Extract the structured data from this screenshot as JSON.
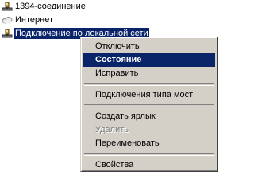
{
  "connections": [
    {
      "label": "1394-соединение",
      "icon": "network-connection-icon"
    },
    {
      "label": "Интернет",
      "icon": "internet-cloud-icon"
    },
    {
      "label": "Подключение по локальной сети",
      "icon": "network-connection-icon",
      "selected": true
    }
  ],
  "context_menu": {
    "items": [
      {
        "label": "Отключить"
      },
      {
        "label": "Состояние",
        "default": true,
        "highlighted": true
      },
      {
        "label": "Исправить"
      },
      {
        "label": "Подключения типа мост"
      },
      {
        "label": "Создать ярлык"
      },
      {
        "label": "Удалить",
        "disabled": true
      },
      {
        "label": "Переименовать"
      },
      {
        "label": "Свойства"
      }
    ]
  },
  "colors": {
    "selection": "#0a246a",
    "menu_face": "#d4d0c8",
    "disabled_text": "#808080"
  }
}
